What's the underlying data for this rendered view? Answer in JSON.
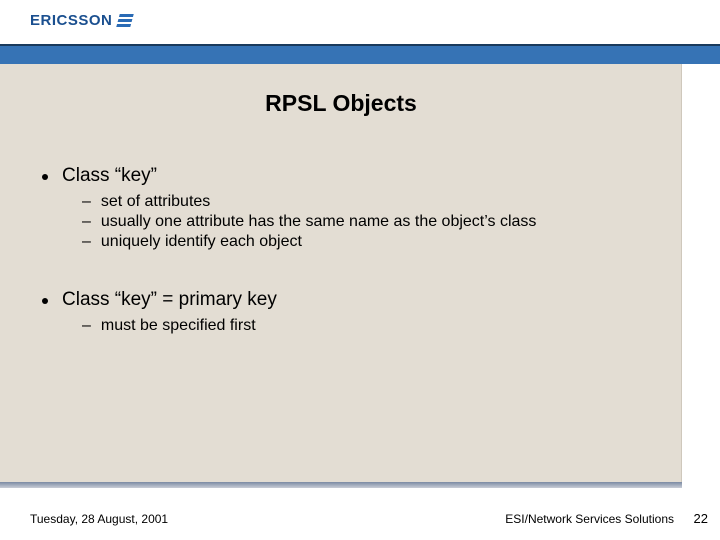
{
  "logo": {
    "text": "ERICSSON"
  },
  "slide": {
    "title": "RPSL Objects",
    "groups": [
      {
        "heading": "Class “key”",
        "items": [
          "set of attributes",
          "usually one attribute has the same name as the object’s class",
          "uniquely identify each object"
        ]
      },
      {
        "heading": "Class “key” = primary key",
        "items": [
          "must be specified first"
        ]
      }
    ]
  },
  "footer": {
    "date": "Tuesday, 28 August, 2001",
    "org": "ESI/Network Services Solutions",
    "page": "22"
  }
}
